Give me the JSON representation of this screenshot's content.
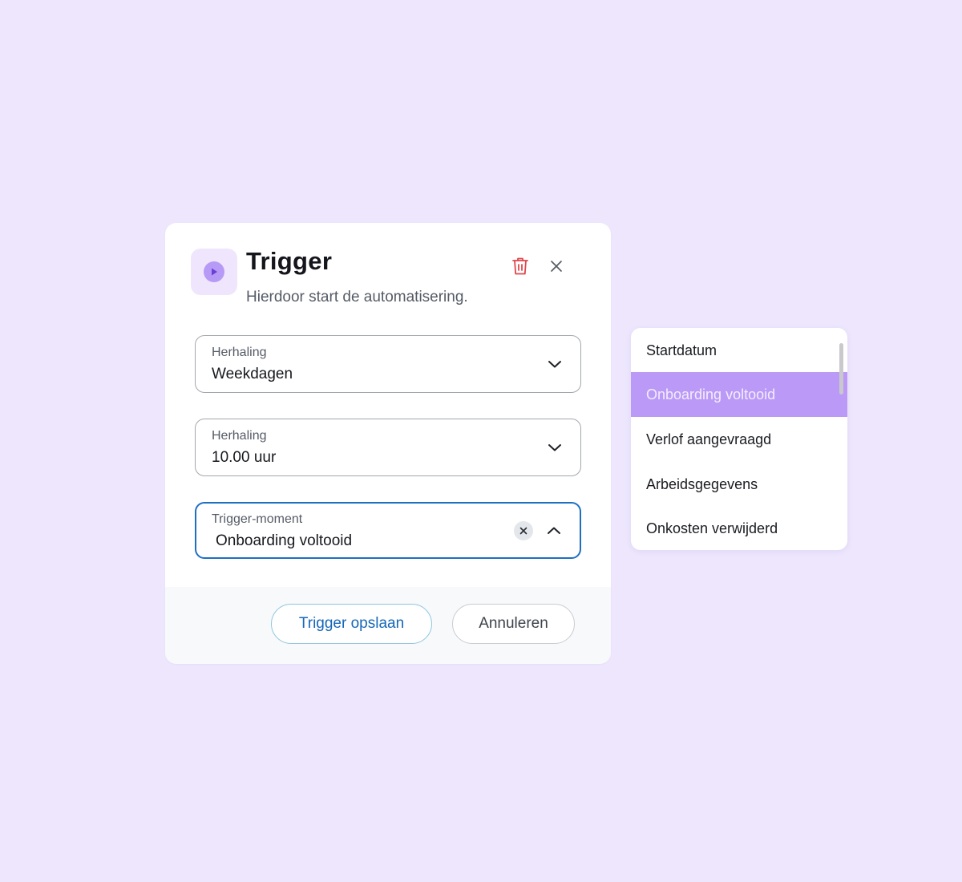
{
  "dialog": {
    "title": "Trigger",
    "subtitle": "Hierdoor start de automatisering.",
    "icon": "play-icon",
    "delete_icon": "trash-icon",
    "close_icon": "close-icon",
    "accent_color": "#b79af5",
    "delete_color": "#e0474c"
  },
  "fields": [
    {
      "label": "Herhaling",
      "value": "Weekdagen",
      "state": "collapsed"
    },
    {
      "label": "Herhaling",
      "value": "10.00 uur",
      "state": "collapsed"
    },
    {
      "label": "Trigger-moment",
      "value": "Onboarding voltooid",
      "state": "expanded"
    }
  ],
  "footer": {
    "save_label": "Trigger opslaan",
    "cancel_label": "Annuleren"
  },
  "dropdown": {
    "options": [
      "Startdatum",
      "Onboarding voltooid",
      "Verlof aangevraagd",
      "Arbeidsgegevens",
      "Onkosten verwijderd"
    ],
    "selected": "Onboarding voltooid",
    "selected_color": "#bb9af7"
  }
}
